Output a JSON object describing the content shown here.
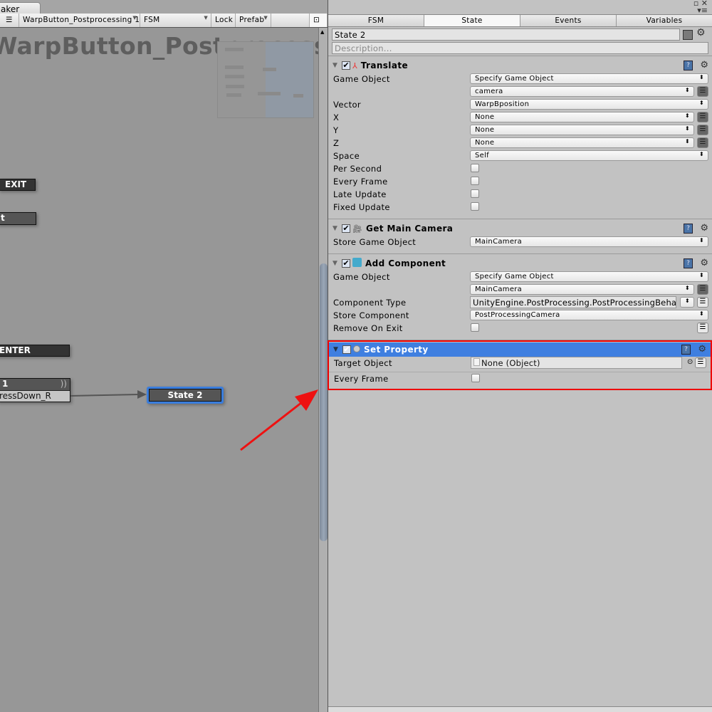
{
  "window_tab": "aker",
  "toolbar": {
    "fsm_owner": "WarpButton_Postprocessing 1",
    "fsm_name": "FSM",
    "lock": "Lock",
    "prefab": "Prefab"
  },
  "graph": {
    "title": "WarpButton_Postprocessing",
    "nodes": {
      "exit_event": "EXIT",
      "state_partial": "t",
      "enter_event": "ENTER",
      "state1_title": "1",
      "state1_transition": "ressDown_R",
      "state2": "State 2"
    },
    "colors": {
      "selected": "#3a7ddc",
      "annotation_arrow": "#ee1111"
    }
  },
  "inspector": {
    "tabs": [
      "FSM",
      "State",
      "Events",
      "Variables"
    ],
    "active_tab": "State",
    "state_name": "State 2",
    "description_placeholder": "Description...",
    "actions": [
      {
        "title": "Translate",
        "icon": "axis-icon",
        "rows": [
          {
            "label": "Game Object",
            "type": "dropdown",
            "value": "Specify Game Object"
          },
          {
            "label": "",
            "type": "dropdown-btn",
            "value": "camera"
          },
          {
            "label": "Vector",
            "type": "dropdown",
            "value": "WarpBposition"
          },
          {
            "label": "X",
            "type": "dropdown-btn",
            "value": "None"
          },
          {
            "label": "Y",
            "type": "dropdown-btn",
            "value": "None"
          },
          {
            "label": "Z",
            "type": "dropdown-btn",
            "value": "None"
          },
          {
            "label": "Space",
            "type": "dropdown",
            "value": "Self"
          },
          {
            "label": "Per Second",
            "type": "checkbox",
            "checked": false
          },
          {
            "label": "Every Frame",
            "type": "checkbox",
            "checked": false
          },
          {
            "label": "Late Update",
            "type": "checkbox",
            "checked": false
          },
          {
            "label": "Fixed Update",
            "type": "checkbox",
            "checked": false
          }
        ]
      },
      {
        "title": "Get Main Camera",
        "icon": "camera-icon",
        "rows": [
          {
            "label": "Store Game Object",
            "type": "dropdown",
            "value": "MainCamera"
          }
        ]
      },
      {
        "title": "Add Component",
        "icon": "cube-icon",
        "rows": [
          {
            "label": "Game Object",
            "type": "dropdown",
            "value": "Specify Game Object"
          },
          {
            "label": "",
            "type": "dropdown-btn",
            "value": "MainCamera"
          },
          {
            "label": "Component Type",
            "type": "text-dd-btn",
            "value": "UnityEngine.PostProcessing.PostProcessingBehavi"
          },
          {
            "label": "Store Component",
            "type": "dropdown",
            "value": "PostProcessingCamera"
          },
          {
            "label": "Remove On Exit",
            "type": "checkbox-btn",
            "checked": false
          }
        ]
      },
      {
        "title": "Set Property",
        "icon": "circle-icon",
        "selected": true,
        "rows": [
          {
            "label": "Target Object",
            "type": "object",
            "value": "None (Object)"
          },
          {
            "label": "Every Frame",
            "type": "checkbox",
            "checked": false
          }
        ]
      }
    ]
  }
}
